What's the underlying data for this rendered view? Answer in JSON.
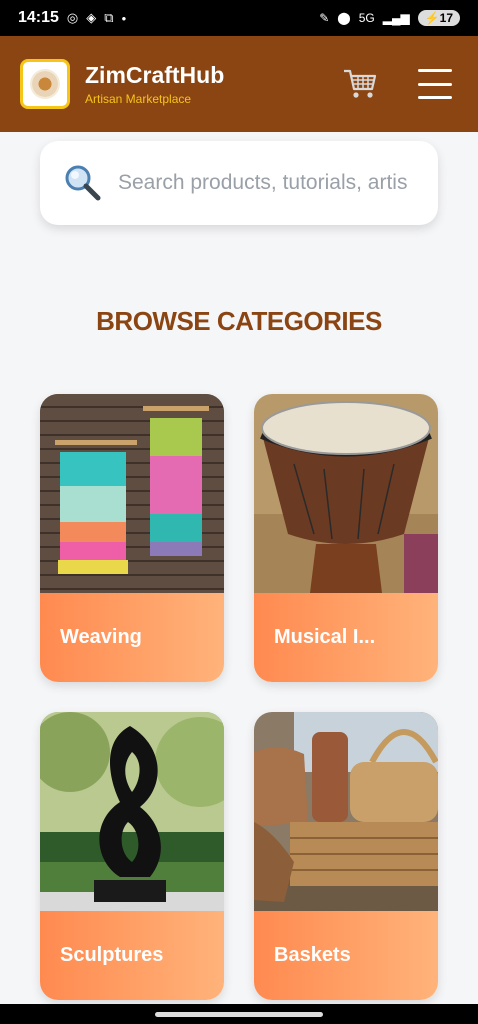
{
  "status": {
    "time": "14:15",
    "network": "5G",
    "battery": "17"
  },
  "header": {
    "app_name": "ZimCraftHub",
    "tagline": "Artisan Marketplace"
  },
  "search": {
    "placeholder": "Search products, tutorials, artis"
  },
  "section": {
    "title": "BROWSE CATEGORIES"
  },
  "categories": [
    {
      "label": "Weaving",
      "image": "woven-wall-hangings"
    },
    {
      "label": "Musical I...",
      "image": "djembe-drum"
    },
    {
      "label": "Sculptures",
      "image": "black-stone-sculpture"
    },
    {
      "label": "Baskets",
      "image": "wicker-baskets"
    }
  ],
  "colors": {
    "header_bg": "#8b4513",
    "accent": "#f5c518",
    "card_gradient_start": "#ff8a50",
    "card_gradient_end": "#ffb37a",
    "title": "#8b4513"
  }
}
